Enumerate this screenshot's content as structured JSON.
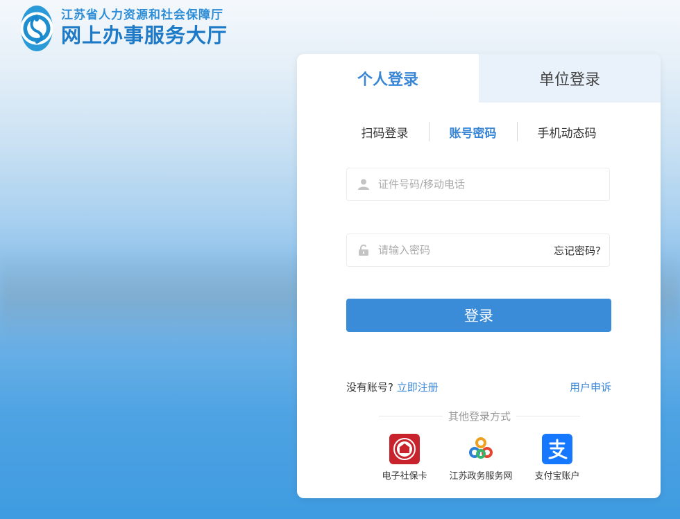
{
  "header": {
    "org_name": "江苏省人力资源和社会保障厅",
    "site_name": "网上办事服务大厅"
  },
  "tabs": [
    {
      "label": "个人登录",
      "active": true
    },
    {
      "label": "单位登录",
      "active": false
    }
  ],
  "subtabs": [
    {
      "label": "扫码登录",
      "active": false
    },
    {
      "label": "账号密码",
      "active": true
    },
    {
      "label": "手机动态码",
      "active": false
    }
  ],
  "form": {
    "account_placeholder": "证件号码/移动电话",
    "account_value": "",
    "password_placeholder": "请输入密码",
    "password_value": "",
    "forgot_label": "忘记密码?",
    "login_label": "登录"
  },
  "links": {
    "no_account": "没有账号?",
    "register": "立即注册",
    "appeal": "用户申诉"
  },
  "other_login": {
    "label": "其他登录方式",
    "methods": [
      {
        "label": "电子社保卡",
        "icon": "social-security-card-icon",
        "color": "#c8232c"
      },
      {
        "label": "江苏政务服务网",
        "icon": "jiangsu-gov-service-icon",
        "color": "#3aa0e6"
      },
      {
        "label": "支付宝账户",
        "icon": "alipay-icon",
        "color": "#1677ff"
      }
    ]
  },
  "colors": {
    "accent": "#3a86d6",
    "button": "#3a8cd9",
    "inactive_tab_bg": "#e9f2fb"
  }
}
